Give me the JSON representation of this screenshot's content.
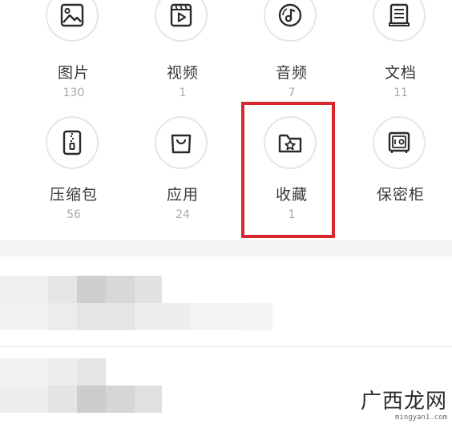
{
  "categories": {
    "images": {
      "label": "图片",
      "count": "130",
      "icon": "image-icon"
    },
    "videos": {
      "label": "视频",
      "count": "1",
      "icon": "video-icon"
    },
    "audio": {
      "label": "音频",
      "count": "7",
      "icon": "music-disc-icon"
    },
    "docs": {
      "label": "文档",
      "count": "11",
      "icon": "document-icon"
    },
    "archives": {
      "label": "压缩包",
      "count": "56",
      "icon": "zip-file-icon"
    },
    "apps": {
      "label": "应用",
      "count": "24",
      "icon": "shopping-bag-icon"
    },
    "favorites": {
      "label": "收藏",
      "count": "1",
      "icon": "star-folder-icon"
    },
    "vault": {
      "label": "保密柜",
      "icon": "safe-icon"
    }
  },
  "annotation": {
    "color": "#d8262c"
  },
  "watermark": {
    "brand": "广西龙网",
    "url": "mingyan1.com"
  },
  "colors": {
    "icon_stroke": "#2a2a2a",
    "circle_border": "#e6e6e6",
    "label_text": "#3a3a3a",
    "count_text": "#a8a8a8",
    "section_gap": "#f3f3f3"
  }
}
